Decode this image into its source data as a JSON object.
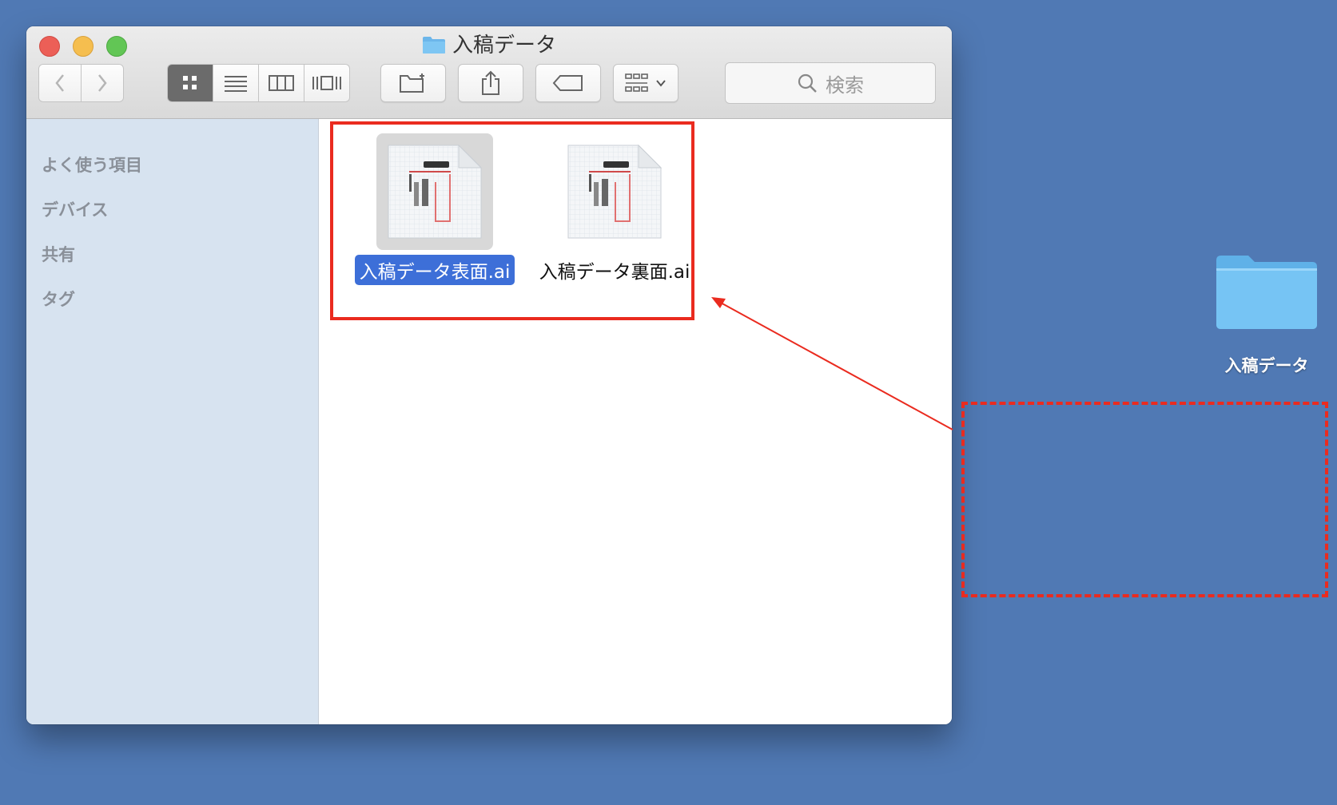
{
  "window": {
    "title": "入稿データ",
    "toolbar": {
      "back_icon": "chevron-left-icon",
      "forward_icon": "chevron-right-icon",
      "view_modes": [
        "icon-view",
        "list-view",
        "column-view",
        "cover-flow-view"
      ],
      "active_view": "icon-view",
      "search_placeholder": "検索"
    },
    "sidebar": {
      "items": [
        {
          "label": "よく使う項目"
        },
        {
          "label": "デバイス"
        },
        {
          "label": "共有"
        },
        {
          "label": "タグ"
        }
      ]
    },
    "files": [
      {
        "name": "入稿データ表面.ai",
        "selected": true
      },
      {
        "name": "入稿データ裏面.ai",
        "selected": false
      }
    ]
  },
  "desktop": {
    "folder_label": "入稿データ",
    "background_color": "#5079b4"
  },
  "annotation": {
    "color": "#ea2b1f"
  }
}
